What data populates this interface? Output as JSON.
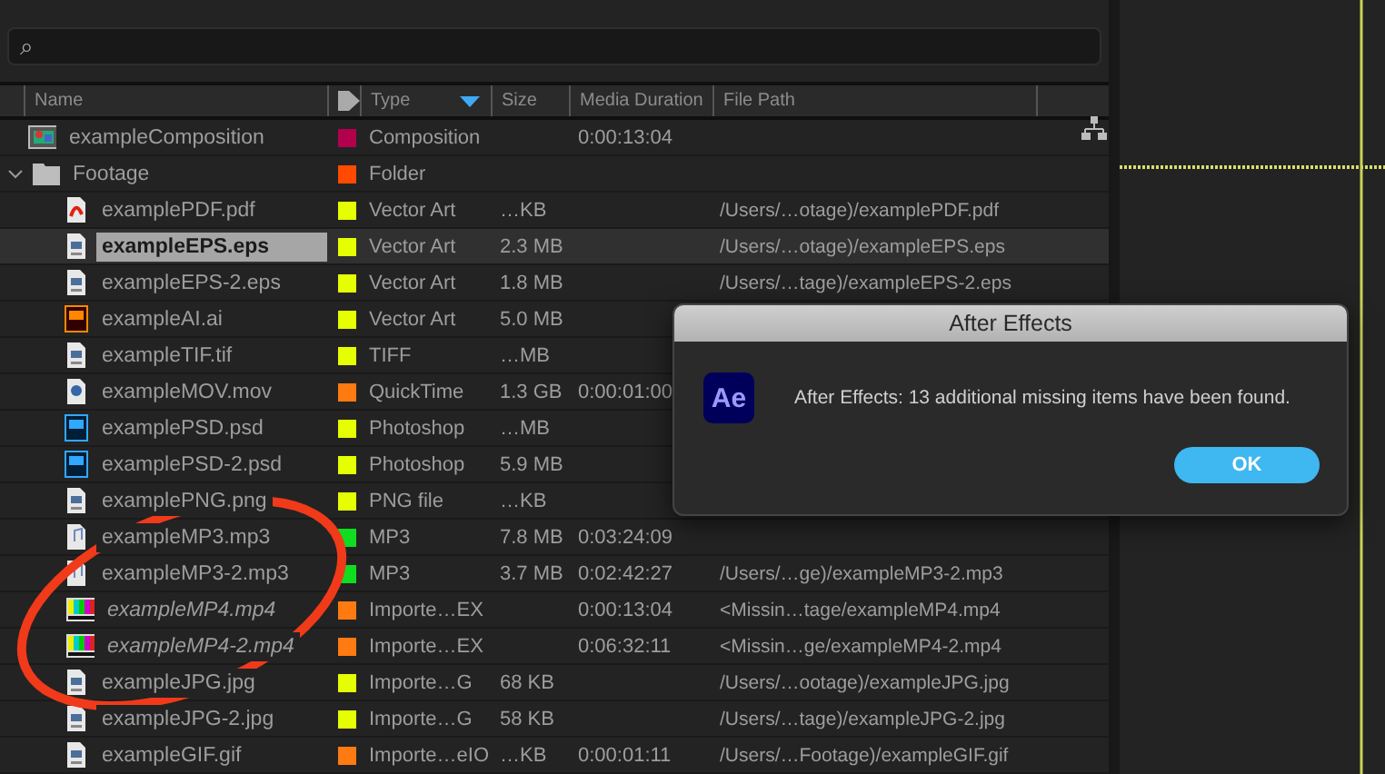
{
  "search": {
    "icon": "⌕"
  },
  "columns": [
    {
      "label": "Name",
      "kind": "text"
    },
    {
      "kind": "tag"
    },
    {
      "label": "Type",
      "kind": "sort"
    },
    {
      "label": "Size",
      "kind": "text"
    },
    {
      "label": "Media Duration",
      "kind": "text"
    },
    {
      "label": "File Path",
      "kind": "text"
    }
  ],
  "rows": [
    {
      "name": "exampleComposition",
      "kind": "composition",
      "color": "#b3004d",
      "type": "Composition",
      "duration": "0:00:13:04",
      "selected": false,
      "missing": false
    },
    {
      "name": "Footage",
      "kind": "folder",
      "color": "#ff4a00",
      "type": "Folder",
      "selected": false,
      "missing": false,
      "expanded": true,
      "children": [
        {
          "name": "examplePDF.pdf",
          "kind": "pdf",
          "color": "#e5ff00",
          "type": "Vector Art",
          "size": "…KB",
          "path": "/Users/…otage)/examplePDF.pdf",
          "selected": false,
          "missing": false
        },
        {
          "name": "exampleEPS.eps",
          "kind": "image",
          "color": "#e5ff00",
          "type": "Vector Art",
          "size": "2.3 MB",
          "path": "/Users/…otage)/exampleEPS.eps",
          "selected": true,
          "missing": false
        },
        {
          "name": "exampleEPS-2.eps",
          "kind": "image",
          "color": "#e5ff00",
          "type": "Vector Art",
          "size": "1.8 MB",
          "path": "/Users/…tage)/exampleEPS-2.eps",
          "selected": false,
          "missing": false
        },
        {
          "name": "exampleAI.ai",
          "kind": "ai",
          "color": "#e5ff00",
          "type": "Vector Art",
          "size": "5.0 MB",
          "selected": false,
          "missing": false
        },
        {
          "name": "exampleTIF.tif",
          "kind": "image",
          "color": "#e5ff00",
          "type": "TIFF",
          "size": "…MB",
          "selected": false,
          "missing": false
        },
        {
          "name": "exampleMOV.mov",
          "kind": "video",
          "color": "#ff7a10",
          "type": "QuickTime",
          "size": "1.3 GB",
          "duration": "0:00:01:00",
          "selected": false,
          "missing": false
        },
        {
          "name": "examplePSD.psd",
          "kind": "psd",
          "color": "#e5ff00",
          "type": "Photoshop",
          "size": "…MB",
          "selected": false,
          "missing": false
        },
        {
          "name": "examplePSD-2.psd",
          "kind": "psd",
          "color": "#e5ff00",
          "type": "Photoshop",
          "size": "5.9 MB",
          "selected": false,
          "missing": false
        },
        {
          "name": "examplePNG.png",
          "kind": "image",
          "color": "#e5ff00",
          "type": "PNG file",
          "size": "…KB",
          "selected": false,
          "missing": false
        },
        {
          "name": "exampleMP3.mp3",
          "kind": "audio",
          "color": "#10dd20",
          "type": "MP3",
          "size": "7.8 MB",
          "duration": "0:03:24:09",
          "selected": false,
          "missing": false
        },
        {
          "name": "exampleMP3-2.mp3",
          "kind": "audio",
          "color": "#10dd20",
          "type": "MP3",
          "size": "3.7 MB",
          "duration": "0:02:42:27",
          "path": "/Users/…ge)/exampleMP3-2.mp3",
          "selected": false,
          "missing": false
        },
        {
          "name": "exampleMP4.mp4",
          "kind": "colorbars",
          "color": "#ff7a10",
          "type": "Importe…EX",
          "duration": "0:00:13:04",
          "path": "<Missin…tage/exampleMP4.mp4",
          "selected": false,
          "missing": true
        },
        {
          "name": "exampleMP4-2.mp4",
          "kind": "colorbars",
          "color": "#ff7a10",
          "type": "Importe…EX",
          "duration": "0:06:32:11",
          "path": "<Missin…ge/exampleMP4-2.mp4",
          "selected": false,
          "missing": true
        },
        {
          "name": "exampleJPG.jpg",
          "kind": "image",
          "color": "#e5ff00",
          "type": "Importe…G",
          "size": "68 KB",
          "path": "/Users/…ootage)/exampleJPG.jpg",
          "selected": false,
          "missing": false
        },
        {
          "name": "exampleJPG-2.jpg",
          "kind": "image",
          "color": "#e5ff00",
          "type": "Importe…G",
          "size": "58 KB",
          "path": "/Users/…tage)/exampleJPG-2.jpg",
          "selected": false,
          "missing": false
        },
        {
          "name": "exampleGIF.gif",
          "kind": "image",
          "color": "#ff7a10",
          "type": "Importe…eIO",
          "size": "…KB",
          "duration": "0:00:01:11",
          "path": "/Users/…Footage)/exampleGIF.gif",
          "selected": false,
          "missing": false
        }
      ]
    }
  ],
  "dialog": {
    "title": "After Effects",
    "logo": "Ae",
    "message": "After Effects: 13 additional missing items have been found.",
    "button": "OK"
  }
}
